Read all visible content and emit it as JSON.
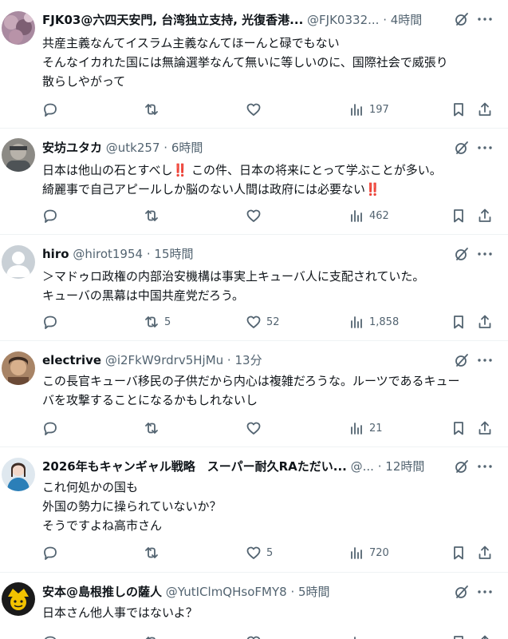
{
  "posts": [
    {
      "display_name": "FJK03@六四天安門, 台湾独立支持, 光復香港...",
      "handle": "@FJK0332...",
      "dot": "·",
      "time": "4時間",
      "lines": [
        "共産主義なんてイスラム主義なんてほーんと碌でもない",
        "そんなイカれた国には無論選挙なんて無いに等しいのに、国際社会で威張り",
        "散らしやがって"
      ],
      "retweets": "",
      "likes": "",
      "views": "197",
      "avatar_colors": [
        "#8a6a7f",
        "#c7a9b9"
      ]
    },
    {
      "display_name": "安坊ユタカ",
      "handle": "@utk257",
      "dot": "·",
      "time": "6時間",
      "lines": [
        "日本は他山の石とすべし‼️ この件、日本の将来にとって学ぶことが多い。",
        "綺麗事で自己アピールしか脳のない人間は政府には必要ない‼️"
      ],
      "retweets": "",
      "likes": "",
      "views": "462",
      "avatar_colors": [
        "#5a5f62",
        "#b7b2aa"
      ]
    },
    {
      "display_name": "hiro",
      "handle": "@hirot1954",
      "dot": "·",
      "time": "15時間",
      "lines": [
        "＞マドゥロ政権の内部治安機構は事実上キューバ人に支配されていた。",
        "キューバの黒幕は中国共産党だろう。"
      ],
      "retweets": "5",
      "likes": "52",
      "views": "1,858",
      "avatar_colors": [
        "#c9d0d6",
        "#ffffff"
      ]
    },
    {
      "display_name": "electrive",
      "handle": "@i2FkW9rdrv5HjMu",
      "dot": "·",
      "time": "13分",
      "lines": [
        "この長官キューバ移民の子供だから内心は複雑だろうな。ルーツであるキュー",
        "バを攻撃することになるかもしれないし"
      ],
      "retweets": "",
      "likes": "",
      "views": "21",
      "avatar_colors": [
        "#6b4a36",
        "#d8b08c"
      ]
    },
    {
      "display_name": "2026年もキャンギャル戦略　スーパー耐久RAただい...",
      "handle": "@...",
      "dot": "·",
      "time": "12時間",
      "lines": [
        "これ何処かの国も",
        "外国の勢力に操られていないか？",
        "そうですよね高市さん"
      ],
      "retweets": "",
      "likes": "5",
      "views": "720",
      "avatar_colors": [
        "#2b7fb8",
        "#f2d7c9"
      ]
    },
    {
      "display_name": "安本@島根推しの薩人",
      "handle": "@YutIClmQHsoFMY8",
      "dot": "·",
      "time": "5時間",
      "lines": [
        "日本さん他人事ではないよ？"
      ],
      "retweets": "",
      "likes": "",
      "views": "",
      "avatar_colors": [
        "#f2c200",
        "#1a1a1a"
      ]
    }
  ]
}
